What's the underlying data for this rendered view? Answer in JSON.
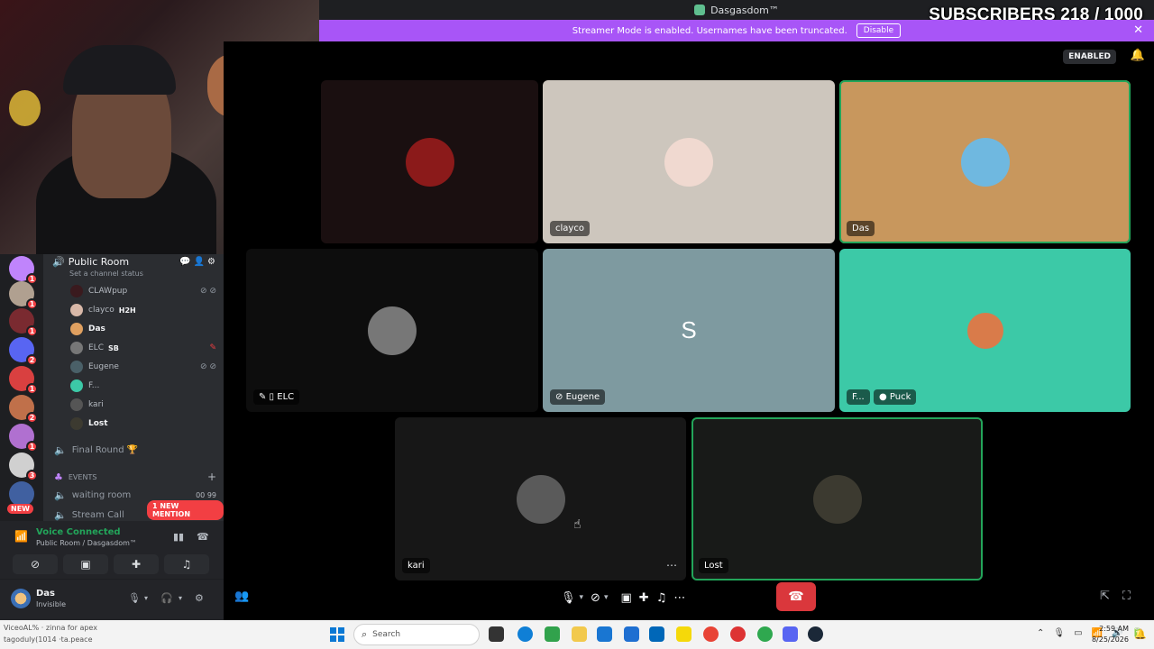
{
  "window": {
    "title": "Dasgasdom™"
  },
  "overlay": {
    "subscribers": "SUBSCRIBERS 218 / 1000"
  },
  "banner": {
    "text": "Streamer Mode is enabled. Usernames have been truncated.",
    "disable_label": "Disable",
    "close_icon": "close-icon"
  },
  "stage": {
    "enabled_label": "ENABLED",
    "tiles": [
      {
        "label": "",
        "bg": "#1a0f10",
        "avatar_color": "#8b1a1a"
      },
      {
        "label": "clayco",
        "bg": "#cdc6bd",
        "avatar_color": "#f0d9d0"
      },
      {
        "label": "Das",
        "bg": "#c8975d",
        "avatar_color": "#6fb8e0"
      },
      {
        "label": "ELC",
        "bg": "#0d0d0d",
        "avatar_color": "#777777"
      },
      {
        "label": "Eugene",
        "bg": "#7e9aa0",
        "letter": "S"
      },
      {
        "label": "F...",
        "extra_label": "Puck",
        "bg": "#3cc9a7",
        "avatar_color": "#d97b4a"
      },
      {
        "label": "kari",
        "bg": "#171717",
        "avatar_color": "#5a5a5a"
      },
      {
        "label": "Lost",
        "bg": "#181a18",
        "avatar_color": "#3c3a30"
      }
    ]
  },
  "sidebar": {
    "channel_name": "Public Room",
    "channel_status": "Set a channel status",
    "members": [
      {
        "name": "CLAWpup",
        "color": "#3a1a1e",
        "tag": "",
        "right": "⊘ ⊘"
      },
      {
        "name": "clayco",
        "color": "#d8b8a8",
        "tag": "H2H",
        "right": ""
      },
      {
        "name": "Das",
        "color": "#e0a060",
        "tag": "",
        "right": "",
        "bold": true
      },
      {
        "name": "ELC",
        "color": "#777777",
        "tag": "SB",
        "right": "✎"
      },
      {
        "name": "Eugene",
        "color": "#4a6068",
        "tag": "",
        "right": "⊘ ⊘"
      },
      {
        "name": "F...",
        "color": "#3cc9a7",
        "tag": "",
        "right": ""
      },
      {
        "name": "kari",
        "color": "#555555",
        "tag": "",
        "right": ""
      },
      {
        "name": "Lost",
        "color": "#3c3a30",
        "tag": "",
        "right": "",
        "bold": true
      }
    ],
    "final_round": "Final Round 🏆",
    "events_label": "EVENTS",
    "waiting_room": "waiting room",
    "waiting_counts": "00 99",
    "stream_call": "Stream Call",
    "mention_pill": "1 NEW MENTION",
    "new_pill": "NEW"
  },
  "servers": [
    {
      "color": "#c084fc",
      "badge": "1"
    },
    {
      "color": "#b0a090",
      "badge": "1"
    },
    {
      "color": "#7a2a30",
      "badge": "1"
    },
    {
      "color": "#5865f2",
      "badge": "2"
    },
    {
      "color": "#d94040",
      "badge": "1"
    },
    {
      "color": "#c0704a",
      "badge": "2"
    },
    {
      "color": "#b070d0",
      "badge": "1"
    },
    {
      "color": "#d0d0d0",
      "badge": "3"
    },
    {
      "color": "#4060a0",
      "badge": ""
    }
  ],
  "voice": {
    "status": "Voice Connected",
    "location": "Public Room / Dasgasdom™"
  },
  "user": {
    "name": "Das",
    "status": "Invisible"
  },
  "taskbar": {
    "tiny_line1": "ViceoAL% · zinna for apex",
    "tiny_line2": "tagoduly(1014 ·ta.peace",
    "search_placeholder": "Search",
    "time": "2:59 AM",
    "date": "8/25/2026"
  }
}
